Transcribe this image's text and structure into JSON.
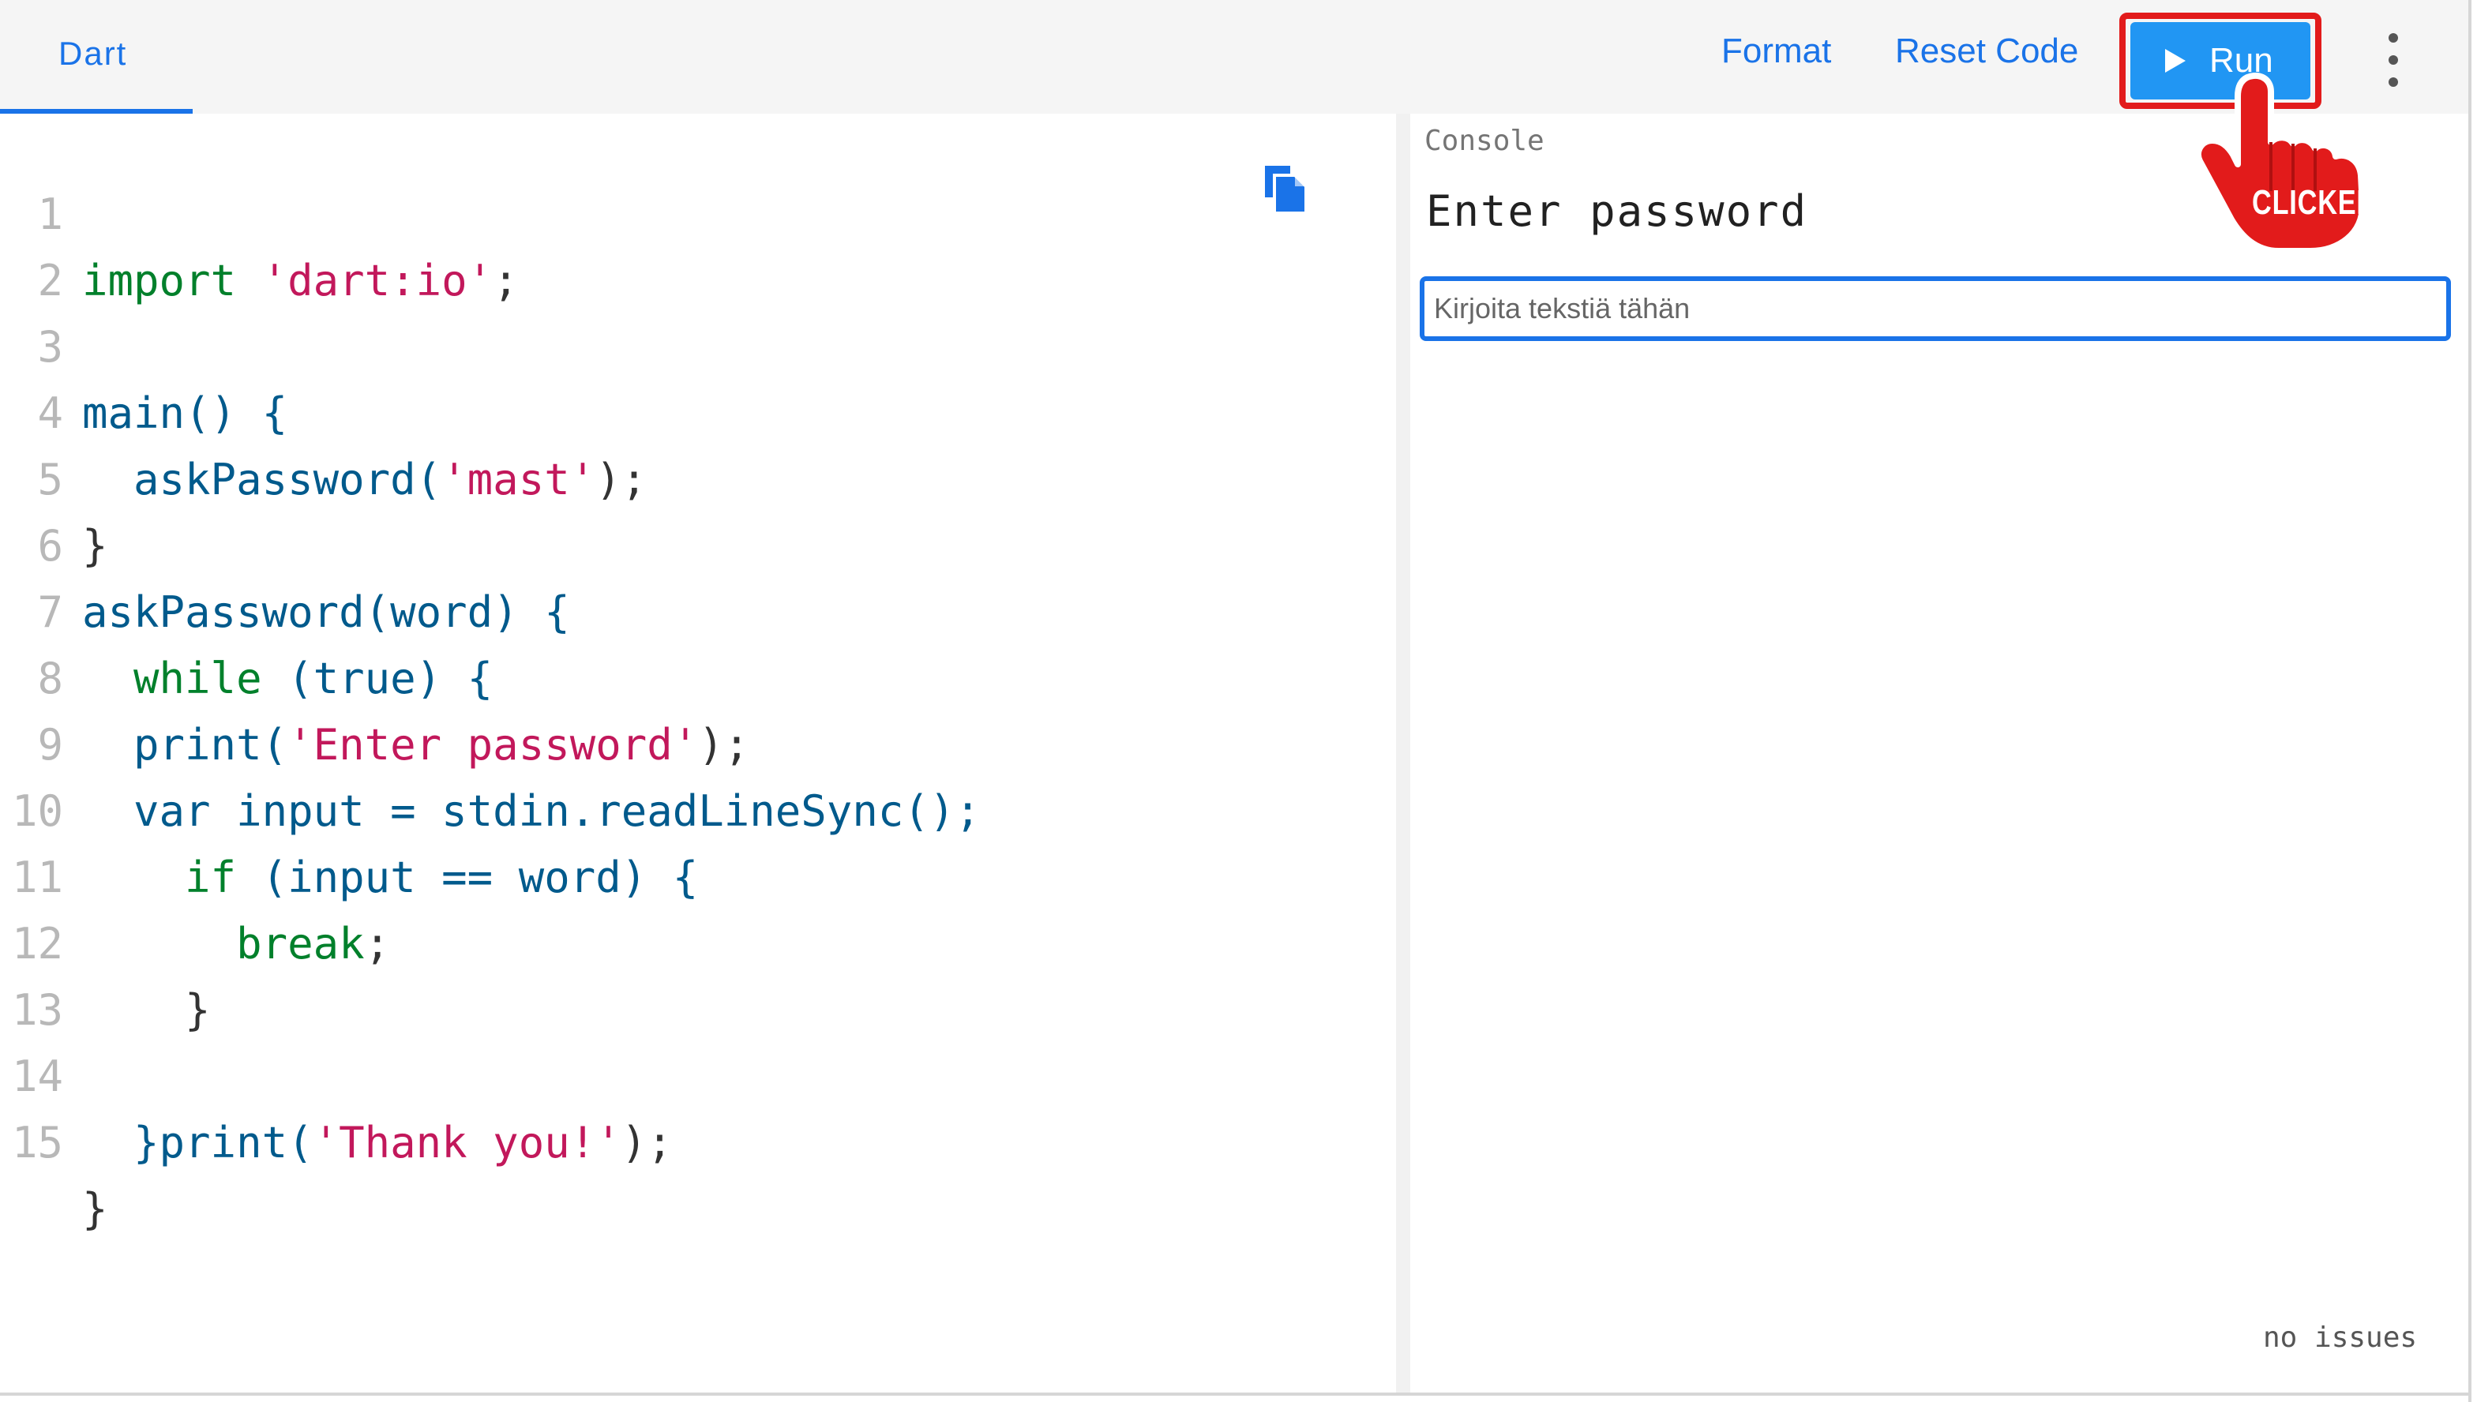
{
  "topbar": {
    "tab_label": "Dart",
    "format_label": "Format",
    "reset_label": "Reset Code",
    "run_label": "Run"
  },
  "editor": {
    "lines": [
      {
        "n": "1"
      },
      {
        "n": "2"
      },
      {
        "n": "3"
      },
      {
        "n": "4"
      },
      {
        "n": "5"
      },
      {
        "n": "6"
      },
      {
        "n": "7"
      },
      {
        "n": "8"
      },
      {
        "n": "9"
      },
      {
        "n": "10"
      },
      {
        "n": "11"
      },
      {
        "n": "12"
      },
      {
        "n": "13"
      },
      {
        "n": "14"
      },
      {
        "n": "15"
      }
    ],
    "code": {
      "l1_kw": "import",
      "l1_str": "'dart:io'",
      "l1_end": ";",
      "l3": "main() {",
      "l4_a": "  askPassword(",
      "l4_str": "'mast'",
      "l4_end": ");",
      "l5": "}",
      "l6": "askPassword(word) {",
      "l7_kw": "  while",
      "l7_rest": " (true) {",
      "l8_a": "  print(",
      "l8_str": "'Enter password'",
      "l8_end": ");",
      "l9": "  var input = stdin.readLineSync();",
      "l10_kw": "    if",
      "l10_rest": " (input == word) {",
      "l11_kw": "      break",
      "l11_end": ";",
      "l12": "    }",
      "l14_a": "  }print(",
      "l14_str": "'Thank you!'",
      "l14_end": ");",
      "l15": "}"
    }
  },
  "console": {
    "title": "Console",
    "output": "Enter password",
    "input_placeholder": "Kirjoita tekstiä tähän",
    "issues": "no issues"
  },
  "overlay": {
    "clicked_label": "CLICKED"
  },
  "colors": {
    "accent": "#1a73e8",
    "run_bg": "#2196f3",
    "highlight": "#e21b1b"
  }
}
